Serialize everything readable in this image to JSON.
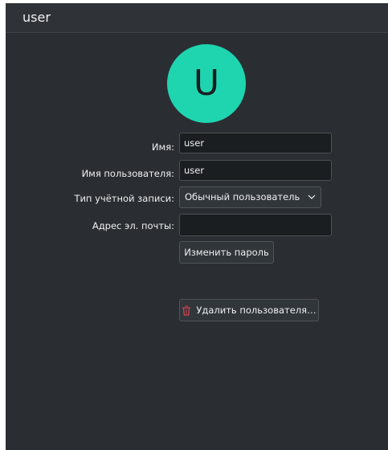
{
  "window": {
    "title": "user"
  },
  "avatar": {
    "letter": "U",
    "color": "#1ed5b0"
  },
  "form": {
    "name_label": "Имя:",
    "name_value": "user",
    "username_label": "Имя пользователя:",
    "username_value": "user",
    "account_type_label": "Тип учётной записи:",
    "account_type_value": "Обычный пользователь",
    "email_label": "Адрес эл. почты:",
    "email_value": ""
  },
  "buttons": {
    "change_password": "Изменить пароль",
    "delete_user": "Удалить пользователя…"
  },
  "icons": {
    "combo_arrow": "chevron-down-icon",
    "delete": "trash-icon"
  }
}
